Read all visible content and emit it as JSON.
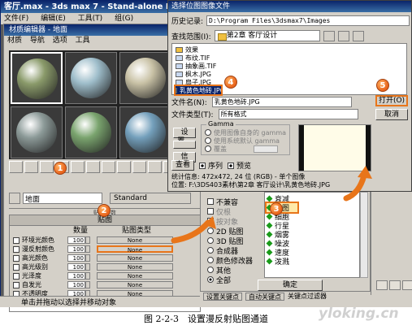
{
  "max_window": {
    "title": "客厅.max - 3ds max 7 - Stand-alone Li",
    "menu": [
      "文件(F)",
      "编辑(E)",
      "工具(T)",
      "组(G)"
    ]
  },
  "material_editor": {
    "title": "材质编辑器 - 地面",
    "menu": [
      "材质",
      "导航",
      "选项",
      "工具"
    ],
    "sphere_colors": [
      "#8a9a6a",
      "#9fbecb",
      "#c9c2a6",
      "#8c9a98",
      "#7aa46e",
      "#74a0bc"
    ],
    "material_name": "地面",
    "material_type": "Standard",
    "basic_params_label": "贴图参数",
    "maps_header": "贴图",
    "col_amount": "数量",
    "col_map_type": "贴图类型",
    "map_rows": [
      {
        "label": "环境光颜色",
        "amount": "100",
        "map": "None"
      },
      {
        "label": "漫反射颜色",
        "amount": "100",
        "map": "None"
      },
      {
        "label": "高光颜色",
        "amount": "100",
        "map": "None"
      },
      {
        "label": "高光级别",
        "amount": "100",
        "map": "None"
      },
      {
        "label": "光泽度",
        "amount": "100",
        "map": "None"
      },
      {
        "label": "自发光",
        "amount": "100",
        "map": "None"
      },
      {
        "label": "不透明度",
        "amount": "100",
        "map": "None"
      },
      {
        "label": "过滤色",
        "amount": "100",
        "map": "None"
      }
    ]
  },
  "map_browser": {
    "options": [
      {
        "label": "不兼容",
        "kind": "box"
      },
      {
        "label": "仅根",
        "kind": "box",
        "disabled": true
      },
      {
        "label": "按对象",
        "kind": "box",
        "disabled": true
      },
      {
        "label": "2D 贴图",
        "kind": "radio"
      },
      {
        "label": "3D 贴图",
        "kind": "radio"
      },
      {
        "label": "合成器",
        "kind": "radio"
      },
      {
        "label": "颜色修改器",
        "kind": "radio"
      },
      {
        "label": "其他",
        "kind": "radio"
      },
      {
        "label": "全部",
        "kind": "radio",
        "on": true
      }
    ],
    "list": [
      "衰减",
      "位图",
      "细胞",
      "行星",
      "烟雾",
      "噪波",
      "速度",
      "泼溅"
    ],
    "ok_label": "确定",
    "bottom_bar": [
      "设置关键点",
      "自动关键点"
    ],
    "bottom_filter": "关键点过滤器"
  },
  "file_dialog": {
    "title": "选择位图图像文件",
    "history_label": "历史记录:",
    "history_path": "D:\\Program Files\\3dsmax7\\Images",
    "lookin_label": "查找范围(I):",
    "lookin_value": "第2章 客厅设计",
    "files": [
      {
        "name": "效果",
        "kind": "folder"
      },
      {
        "name": "布纹.TIF",
        "kind": "img"
      },
      {
        "name": "抽象画.TIF",
        "kind": "img"
      },
      {
        "name": "枫木.JPG",
        "kind": "img"
      },
      {
        "name": "扇子.JPG",
        "kind": "img"
      },
      {
        "name": "乳黄色地砖.JPG",
        "kind": "img",
        "selected": true
      }
    ],
    "filename_label": "文件名(N):",
    "filename_value": "乳黄色地砖.JPG",
    "filetype_label": "文件类型(T):",
    "filetype_value": "所有格式",
    "open_label": "打开(O)",
    "cancel_label": "取消",
    "setup_label": "设置...",
    "info_label": "信息...",
    "view_label": "查看",
    "gamma_title": "Gamma",
    "gamma_options": [
      "使用图像自身的 gamma",
      "使用系统默认 gamma",
      "覆盖"
    ],
    "sequence_label": "序列",
    "preview_label": "预览",
    "stats_line": "统计信息: 472x472, 24 位 (RGB) - 单个图像",
    "location_line": "位置: F:\\3DS403素材\\第2章 客厅设计\\乳黄色地砖.JPG"
  },
  "status_text": "单击并拖动以选择并移动对象",
  "callouts": [
    "1",
    "2",
    "3",
    "4",
    "5"
  ],
  "caption": "图 2-2-3　设置漫反射贴图通道",
  "watermark": "yloking.cn",
  "colors": {
    "callout": "#e8621a",
    "highlight": "#e8751a",
    "titlebar": "#0a246a"
  }
}
